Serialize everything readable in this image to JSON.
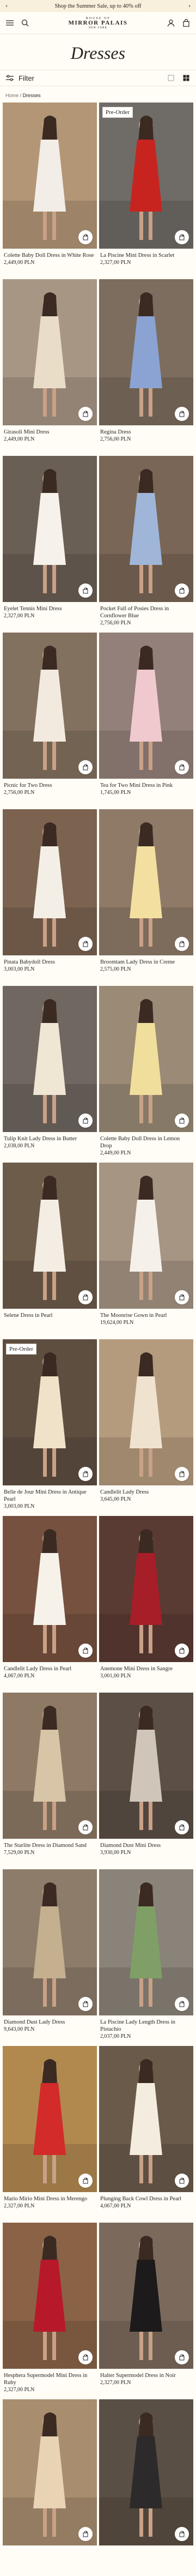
{
  "promo": {
    "text": "Shop the Summer Sale, up to 40% off",
    "prev_icon": "chevron-left-icon",
    "next_icon": "chevron-right-icon"
  },
  "header": {
    "brand_top": "HOUSE OF",
    "brand_main": "MIRROR PALAIS",
    "brand_sub": "NEW YORK",
    "icons": [
      "menu-icon",
      "search-icon",
      "account-icon",
      "bag-icon"
    ]
  },
  "page": {
    "title": "Dresses"
  },
  "filter": {
    "label": "Filter",
    "view_icons": [
      "single-column-icon",
      "grid-icon"
    ]
  },
  "breadcrumb": {
    "home": "Home",
    "sep": "/",
    "current": "Dresses"
  },
  "colors": {
    "background": "#fffdf6",
    "promo_bg": "#f8f0dc",
    "text": "#2a2320"
  },
  "products": [
    {
      "name": "Colette Baby Doll Dress in White Rose",
      "price": "2,449,00 PLN",
      "badge": "",
      "bg": "#b39676",
      "dress": "#f2ede6"
    },
    {
      "name": "La Piscine Mini Dress in Scarlet",
      "price": "2,327,00 PLN",
      "badge": "Pre-Order",
      "bg": "#6f6b66",
      "dress": "#c8241f"
    },
    {
      "name": "Girasoli Mini Dress",
      "price": "2,449,00 PLN",
      "badge": "",
      "bg": "#a89684",
      "dress": "#e9ddc8"
    },
    {
      "name": "Regina Dress",
      "price": "2,756,00 PLN",
      "badge": "",
      "bg": "#7d6d5e",
      "dress": "#8aa3d2"
    },
    {
      "name": "Eyelet Tennis Mini Dress",
      "price": "2,327,00 PLN",
      "badge": "",
      "bg": "#6a5f55",
      "dress": "#f6f1ea"
    },
    {
      "name": "Pocket Full of Posies Dress in Cornflower Blue",
      "price": "2,756,00 PLN",
      "badge": "",
      "bg": "#7a6656",
      "dress": "#9fb6d9"
    },
    {
      "name": "Picnic for Two Dress",
      "price": "2,756,00 PLN",
      "badge": "",
      "bg": "#83715f",
      "dress": "#f2eadf"
    },
    {
      "name": "Tea for Two Mini Dress in Pink",
      "price": "1,745,00 PLN",
      "badge": "",
      "bg": "#94807a",
      "dress": "#f0c9cf"
    },
    {
      "name": "Pinata Babydoll Dress",
      "price": "3,003,00 PLN",
      "badge": "",
      "bg": "#7b6350",
      "dress": "#f4efe6"
    },
    {
      "name": "Broomtam Lady Dress in Creme",
      "price": "2,575,00 PLN",
      "badge": "",
      "bg": "#8f7a68",
      "dress": "#f3dfa0"
    },
    {
      "name": "Tulip Knit Lady Dress in Butter",
      "price": "2,038,00 PLN",
      "badge": "",
      "bg": "#6f6760",
      "dress": "#efe7d4"
    },
    {
      "name": "Colette Baby Doll Dress in Lemon Drop",
      "price": "2,449,00 PLN",
      "badge": "",
      "bg": "#9a8a76",
      "dress": "#f0df9c"
    },
    {
      "name": "Selene Dress in Pearl",
      "price": "",
      "badge": "",
      "bg": "#6e5c4b",
      "dress": "#f3ede3"
    },
    {
      "name": "The Moonrise Gown in Pearl",
      "price": "19,624,00 PLN",
      "badge": "",
      "bg": "#a69583",
      "dress": "#f5f1ea"
    },
    {
      "name": "Belle de Jour Mini Dress in Antique Pearl",
      "price": "3,003,00 PLN",
      "badge": "Pre-Order",
      "bg": "#5e4e40",
      "dress": "#efe2c9"
    },
    {
      "name": "Candlelit Lady Dress",
      "price": "3,645,00 PLN",
      "badge": "",
      "bg": "#b59b7e",
      "dress": "#efe3cf"
    },
    {
      "name": "Candlelit Lady Dress in Pearl",
      "price": "4,067,00 PLN",
      "badge": "",
      "bg": "#77513f",
      "dress": "#f6f2ea"
    },
    {
      "name": "Anemone Mini Dress in Sangre",
      "price": "3,001,00 PLN",
      "badge": "",
      "bg": "#5a3b33",
      "dress": "#a51e28"
    },
    {
      "name": "The Starlite Dress in Diamond Sand",
      "price": "7,529,00 PLN",
      "badge": "",
      "bg": "#8e7965",
      "dress": "#d8c4a6"
    },
    {
      "name": "Diamond Dust Mini Dress",
      "price": "3,930,00 PLN",
      "badge": "",
      "bg": "#5c4f46",
      "dress": "#cfc6b9"
    },
    {
      "name": "Diamond Dust Lady Dress",
      "price": "9,643,00 PLN",
      "badge": "",
      "bg": "#8e7c6a",
      "dress": "#c4b08f"
    },
    {
      "name": "La Piscine Lady Length Dress in Pistachio",
      "price": "2,037,00 PLN",
      "badge": "",
      "bg": "#8a8379",
      "dress": "#7f9f67"
    },
    {
      "name": "Mario Mirio Mini Dress in Merengo",
      "price": "2,327,00 PLN",
      "badge": "",
      "bg": "#b1894f",
      "dress": "#d32a2a"
    },
    {
      "name": "Plunging Back Cowl Dress in Pearl",
      "price": "4,067,00 PLN",
      "badge": "",
      "bg": "#6a5a4a",
      "dress": "#f3ecdf"
    },
    {
      "name": "Hesphera Supermodel Mini Dress in Ruby",
      "price": "2,327,00 PLN",
      "badge": "",
      "bg": "#8a6347",
      "dress": "#b8192a"
    },
    {
      "name": "Halter Supermodel Dress in Noir",
      "price": "2,327,00 PLN",
      "badge": "",
      "bg": "#7b6a5c",
      "dress": "#1c1a1a"
    },
    {
      "name": "",
      "price": "",
      "badge": "",
      "bg": "#a88e6f",
      "dress": "#e8d4b4"
    },
    {
      "name": "",
      "price": "",
      "badge": "",
      "bg": "#5a4f44",
      "dress": "#2c2a2a"
    }
  ]
}
